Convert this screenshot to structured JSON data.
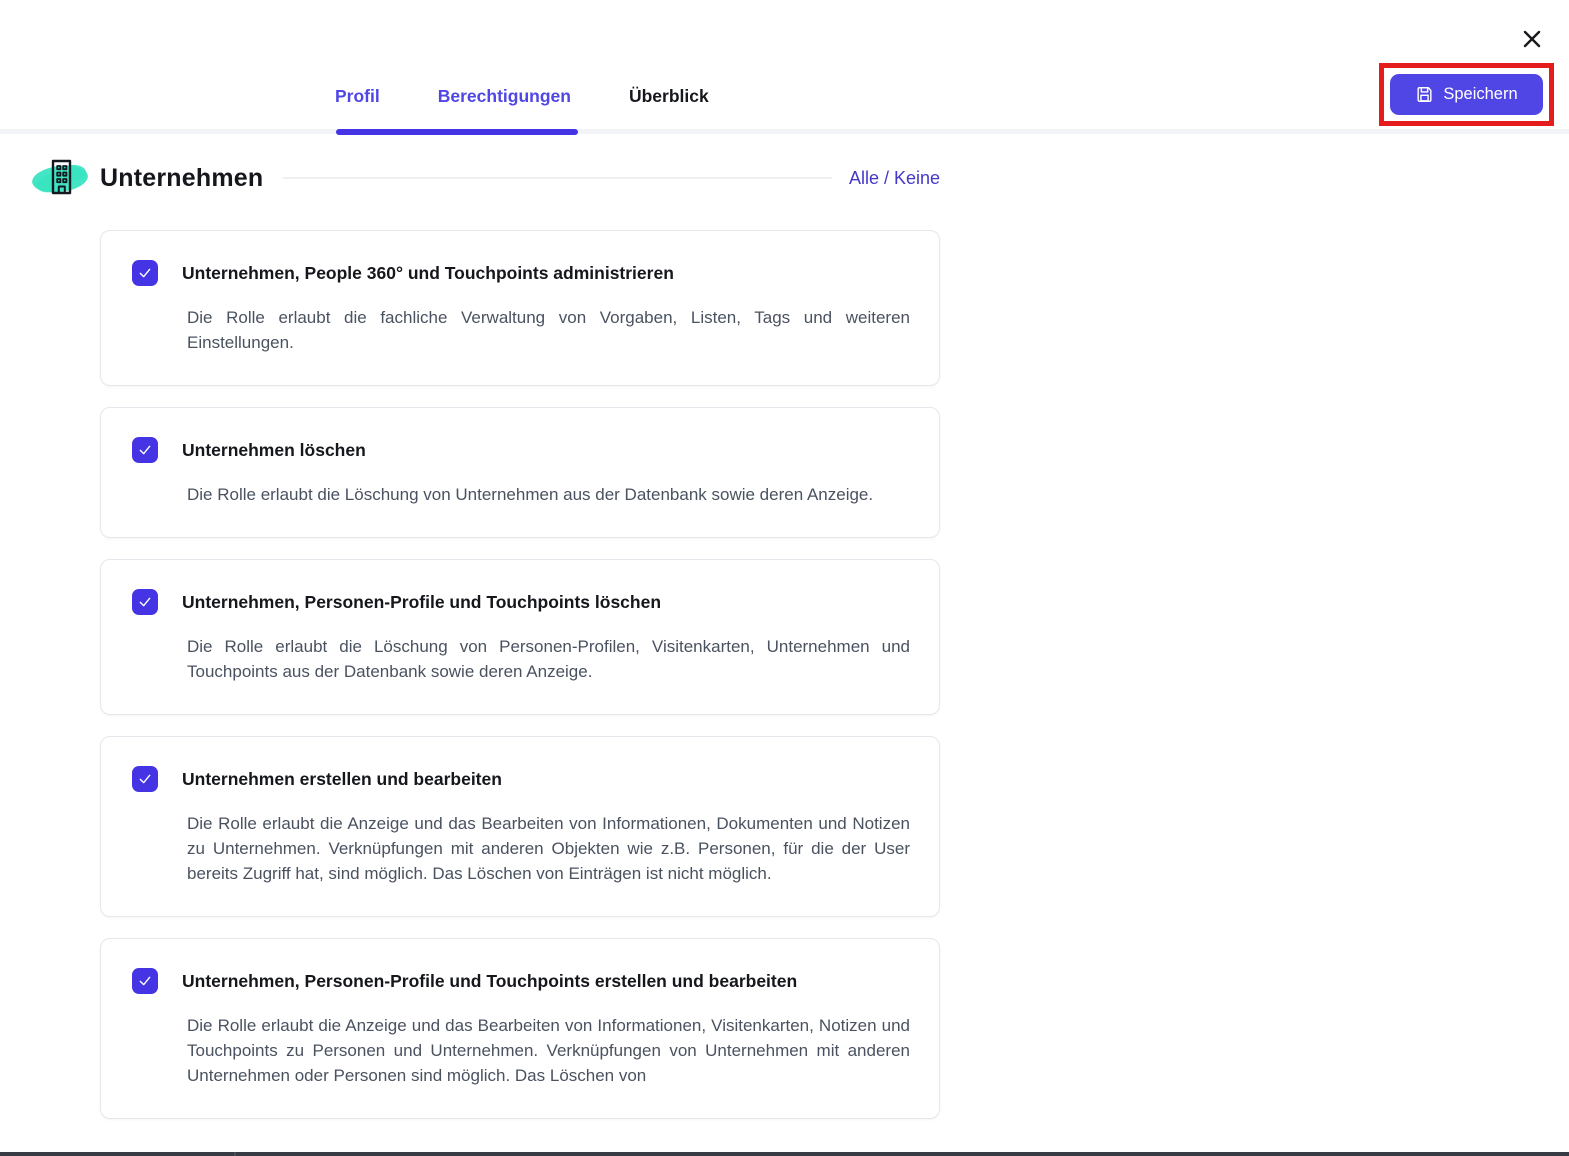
{
  "tabs": {
    "items": [
      {
        "label": "Profil",
        "active": true
      },
      {
        "label": "Berechtigungen",
        "active": true
      },
      {
        "label": "Überblick",
        "active": false
      }
    ]
  },
  "toolbar": {
    "save_label": "Speichern"
  },
  "section": {
    "title": "Unternehmen",
    "bulk_toggle_label": "Alle / Keine"
  },
  "permissions": [
    {
      "checked": true,
      "title": "Unternehmen, People 360° und Touchpoints administrieren",
      "description": "Die Rolle erlaubt die fachliche Verwaltung von Vorgaben, Listen, Tags und weiteren Einstellungen."
    },
    {
      "checked": true,
      "title": "Unternehmen löschen",
      "description": "Die Rolle erlaubt die Löschung von Unternehmen aus der Datenbank sowie deren Anzeige."
    },
    {
      "checked": true,
      "title": "Unternehmen, Personen-Profile und Touchpoints löschen",
      "description": "Die Rolle erlaubt die Löschung von Personen-Profilen, Visitenkarten, Unternehmen und Touchpoints aus der Datenbank sowie deren Anzeige."
    },
    {
      "checked": true,
      "title": "Unternehmen erstellen und bearbeiten",
      "description": "Die Rolle erlaubt die Anzeige und das Bearbeiten von Informationen, Dokumenten und Notizen zu Unternehmen. Verknüpfungen mit anderen Objekten wie z.B. Personen, für die der User bereits Zugriff hat, sind möglich. Das Löschen von Einträgen ist nicht möglich."
    },
    {
      "checked": true,
      "title": "Unternehmen, Personen-Profile und Touchpoints erstellen und bearbeiten",
      "description": "Die Rolle erlaubt die Anzeige und das Bearbeiten von Informationen, Visitenkarten, Notizen und Touchpoints zu Personen und Unternehmen. Verknüpfungen von Unternehmen mit anderen Unternehmen oder Personen sind möglich. Das Löschen von"
    }
  ],
  "colors": {
    "accent": "#4434e4",
    "tab_active": "#4f46e5",
    "button": "#4f46e5",
    "link": "#4338ca",
    "annotation": "#e51c1c",
    "icon_highlight": "#38e4c1"
  }
}
